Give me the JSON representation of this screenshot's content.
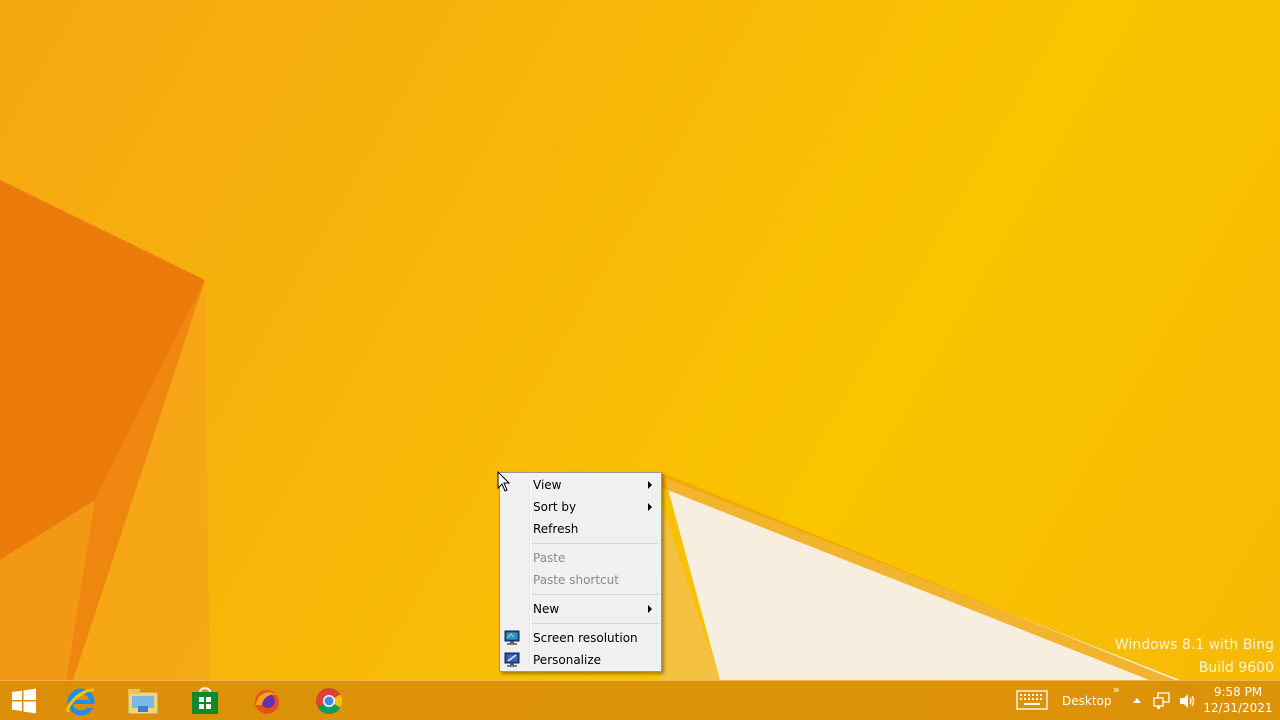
{
  "watermark": {
    "line1": "Windows 8.1 with Bing",
    "line2": "Build 9600"
  },
  "context_menu": {
    "items": [
      {
        "label": "View",
        "submenu": true,
        "enabled": true
      },
      {
        "label": "Sort by",
        "submenu": true,
        "enabled": true
      },
      {
        "label": "Refresh",
        "submenu": false,
        "enabled": true
      },
      {
        "label": "Paste",
        "submenu": false,
        "enabled": false
      },
      {
        "label": "Paste shortcut",
        "submenu": false,
        "enabled": false
      },
      {
        "label": "New",
        "submenu": true,
        "enabled": true
      },
      {
        "label": "Screen resolution",
        "icon": "display-settings-icon",
        "enabled": true
      },
      {
        "label": "Personalize",
        "icon": "personalize-icon",
        "enabled": true
      }
    ]
  },
  "taskbar": {
    "pinned": [
      {
        "name": "start",
        "icon": "windows-logo-icon"
      },
      {
        "name": "internet-explorer",
        "icon": "internet-explorer-icon"
      },
      {
        "name": "file-explorer",
        "icon": "file-explorer-icon"
      },
      {
        "name": "store",
        "icon": "store-icon"
      },
      {
        "name": "firefox",
        "icon": "firefox-icon"
      },
      {
        "name": "chrome",
        "icon": "chrome-icon"
      }
    ],
    "desktop_toolbar_label": "Desktop",
    "chevron": "»",
    "clock": {
      "time": "9:58 PM",
      "date": "12/31/2021"
    }
  },
  "colors": {
    "wallpaper_base": "#f9c400",
    "wallpaper_orange": "#ee7f0a",
    "taskbar": "#d88c08",
    "menu_bg": "#f0f0f0"
  }
}
